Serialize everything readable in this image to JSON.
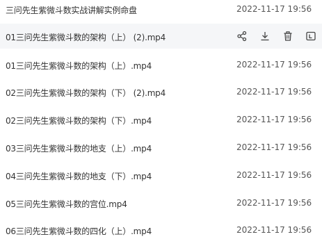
{
  "files": [
    {
      "name": "三问先生紫微斗数实战讲解实例命盘",
      "date": "2022-11-17 19:56"
    },
    {
      "name": "01三问先生紫微斗数的架构（上） (2).mp4",
      "date": "",
      "hovered": true
    },
    {
      "name": "01三问先生紫微斗数的架构（上）.mp4",
      "date": "2022-11-17 19:56"
    },
    {
      "name": "02三问先生紫微斗数的架构（下） (2).mp4",
      "date": "2022-11-17 19:56"
    },
    {
      "name": "02三问先生紫微斗数的架构（下）.mp4",
      "date": "2022-11-17 19:56"
    },
    {
      "name": "03三问先生紫微斗数的地支（上）.mp4",
      "date": "2022-11-17 19:56"
    },
    {
      "name": "04三问先生紫微斗数的地支（下）.mp4",
      "date": "2022-11-17 19:56"
    },
    {
      "name": "05三问先生紫微斗数的宫位.mp4",
      "date": "2022-11-17 19:56"
    },
    {
      "name": "06三问先生紫微斗数的四化（上）.mp4",
      "date": "2022-11-17 19:56"
    }
  ],
  "hover_actions": [
    "share-icon",
    "download-icon",
    "delete-icon",
    "more-icon"
  ],
  "colors": {
    "hover_bg": "#f5f6f8",
    "text": "#333333",
    "icon": "#444444"
  }
}
